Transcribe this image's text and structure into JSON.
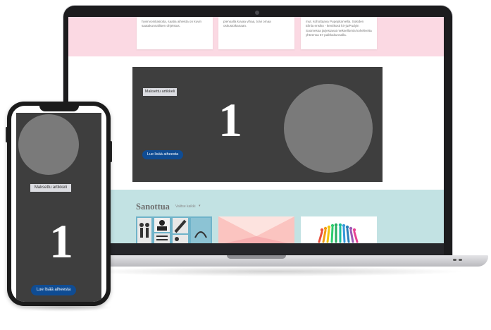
{
  "laptop": {
    "cards": [
      {
        "text": "hyvinvointiasioita, saatia aiheista on kuvin saatakunnallisen ohjeistus."
      },
      {
        "text": "pienoalla kuvaa vihaa, toivi omaa oskustoikanaan."
      },
      {
        "text": "mut. kohottaava Pupepitarvella. Sokiden Elinla ensiko - kentikosti kir-ju/Pudyin Suomessa jarjestavat meksellomia koheliveita yhteensa 57 paikkakunnalla."
      }
    ],
    "promo": {
      "badge": "Maksettu artikkeli",
      "number": "1",
      "button": "Lue lisää aiheesta"
    },
    "section": {
      "title": "Sanottua",
      "filter_label": "Valitse kaikki",
      "filter_arrow": "▾"
    },
    "colors": {
      "pink": "#fbd9e3",
      "teal": "#c2e2e3",
      "promo_bg": "#3e3e3e",
      "button_blue": "#0f4c93"
    }
  },
  "phone": {
    "promo": {
      "badge": "Maksettu artikkeli",
      "number": "1",
      "button": "Lue lisää aiheesta"
    }
  }
}
